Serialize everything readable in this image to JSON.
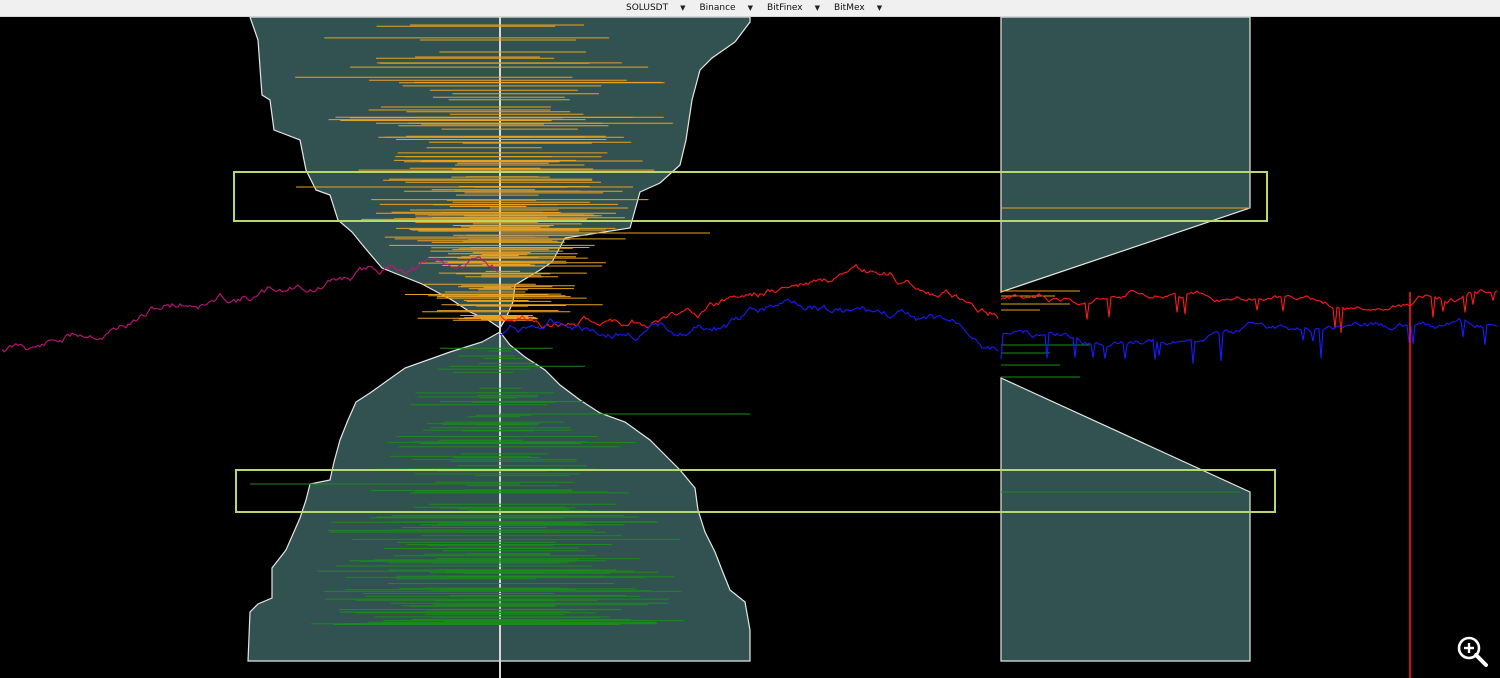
{
  "toolbar": {
    "selectors": [
      {
        "name": "symbol-select",
        "label": "SOLUSDT"
      },
      {
        "name": "exchange-binance-select",
        "label": "Binance"
      },
      {
        "name": "exchange-bitfinex-select",
        "label": "BitFinex"
      },
      {
        "name": "exchange-bitmex-select",
        "label": "BitMex"
      }
    ]
  },
  "icons": {
    "dropdown": "chevron-down-icon",
    "zoom": "zoom-in-icon"
  },
  "colors": {
    "background": "#000000",
    "depth_fill": "#325251",
    "depth_outline": "#e6e6e6",
    "ask_lines": "#e8a020",
    "bid_lines": "#1a8a1a",
    "highlight_box": "#b7d86a",
    "price_red": "#ff1a1a",
    "price_blue": "#1a1aff",
    "price_magenta": "#c0147a"
  }
}
